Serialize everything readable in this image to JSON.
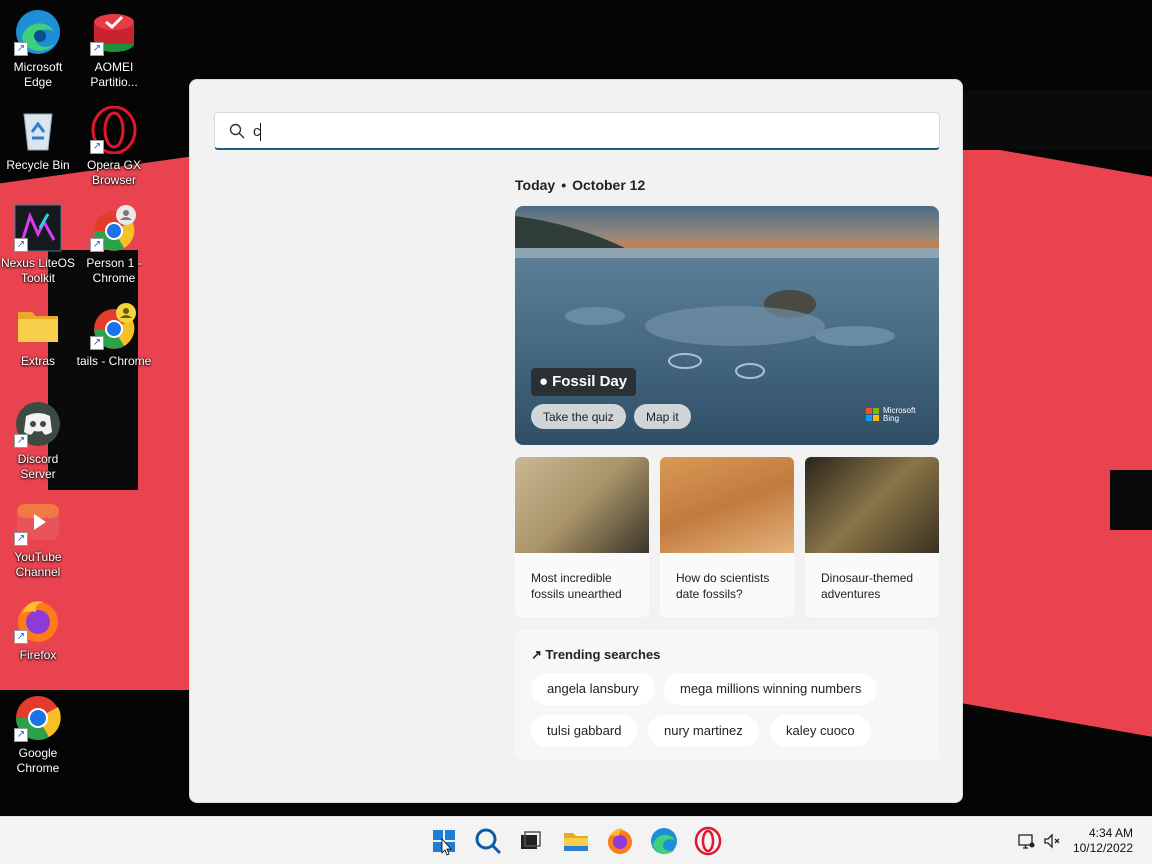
{
  "desktop": {
    "icons": [
      {
        "label": "Microsoft Edge",
        "icon": "edge-icon"
      },
      {
        "label": "AOMEI Partitio...",
        "icon": "aomei-icon"
      },
      {
        "label": "Recycle Bin",
        "icon": "recycle-bin-icon"
      },
      {
        "label": "Opera GX Browser",
        "icon": "opera-gx-icon"
      },
      {
        "label": "Nexus LiteOS Toolkit",
        "icon": "nexus-toolkit-icon"
      },
      {
        "label": "Person 1 - Chrome",
        "icon": "chrome-profile-icon"
      },
      {
        "label": "Extras",
        "icon": "folder-icon"
      },
      {
        "label": "tails - Chrome",
        "icon": "chrome-profile-icon"
      },
      {
        "label": "Discord Server",
        "icon": "discord-icon"
      },
      {
        "label": "YouTube Channel",
        "icon": "youtube-icon"
      },
      {
        "label": "Firefox",
        "icon": "firefox-icon"
      },
      {
        "label": "Google Chrome",
        "icon": "chrome-icon"
      }
    ]
  },
  "search": {
    "query": "c",
    "today_label": "Today",
    "date": "October 12",
    "hero": {
      "tag": "Fossil Day",
      "buttons": [
        "Take the quiz",
        "Map it"
      ],
      "brand_line1": "Microsoft",
      "brand_line2": "Bing"
    },
    "cards": [
      {
        "title": "Most incredible fossils unearthed"
      },
      {
        "title": "How do scientists date fossils?"
      },
      {
        "title": "Dinosaur-themed adventures"
      }
    ],
    "trending": {
      "header": "Trending searches",
      "items": [
        "angela lansbury",
        "mega millions winning numbers",
        "tulsi gabbard",
        "nury martinez",
        "kaley cuoco"
      ]
    }
  },
  "taskbar": {
    "apps": [
      "start-icon",
      "search-icon",
      "task-view-icon",
      "file-explorer-icon",
      "firefox-icon",
      "edge-icon",
      "opera-icon"
    ],
    "time": "4:34 AM",
    "date": "10/12/2022"
  },
  "colors": {
    "accent": "#1f5f7a",
    "wallpaper_red": "#e8434f"
  }
}
